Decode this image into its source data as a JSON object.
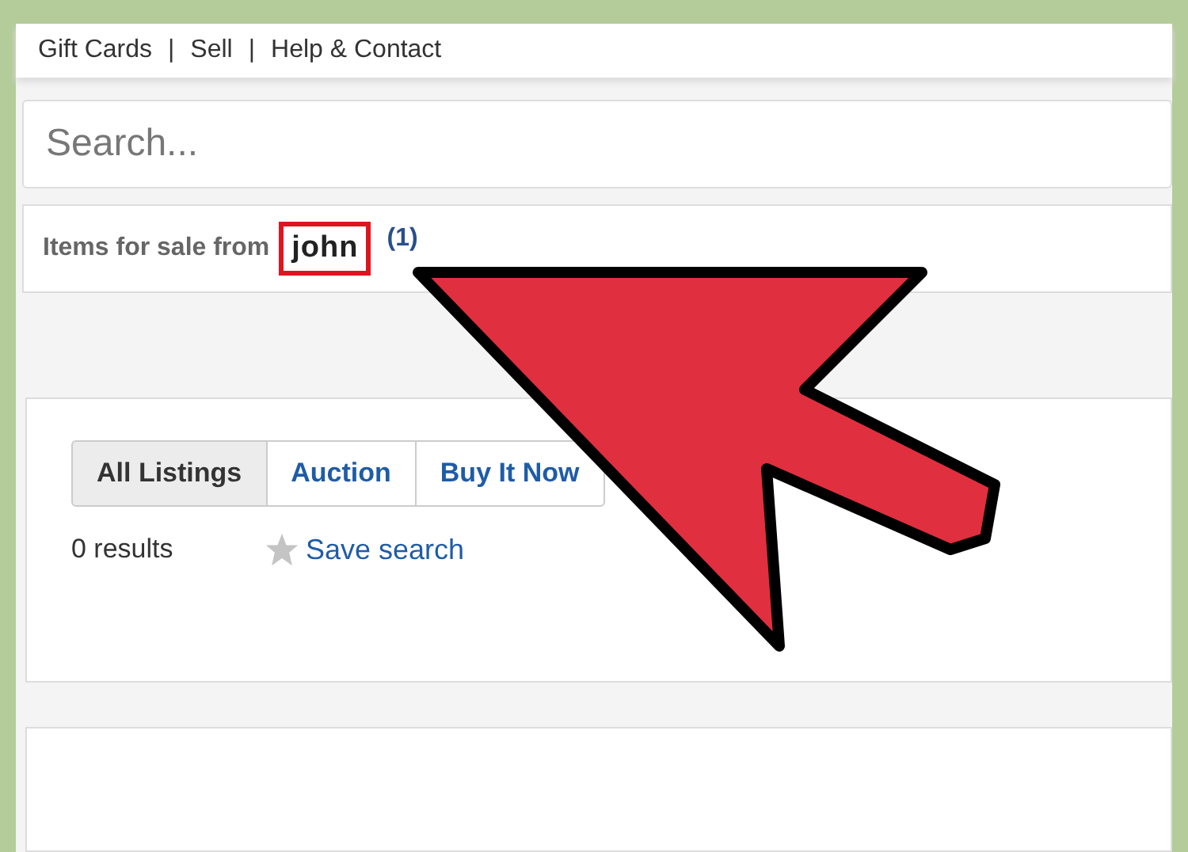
{
  "top_nav": [
    {
      "label": "Gift Cards"
    },
    {
      "separator": "|",
      "label": "Sell"
    },
    {
      "separator": "|",
      "label": "Help & Contact"
    }
  ],
  "search": {
    "placeholder": "Search..."
  },
  "seller_bar": {
    "label": "Items for sale from",
    "seller": "john",
    "highlighted": true,
    "count": "(1)"
  },
  "tabs": [
    {
      "label": "All Listings",
      "selected": true
    },
    {
      "label": "Auction",
      "selected": false
    },
    {
      "label": "Buy It Now",
      "selected": false
    }
  ],
  "results": "0 results",
  "save_search": "Save search"
}
